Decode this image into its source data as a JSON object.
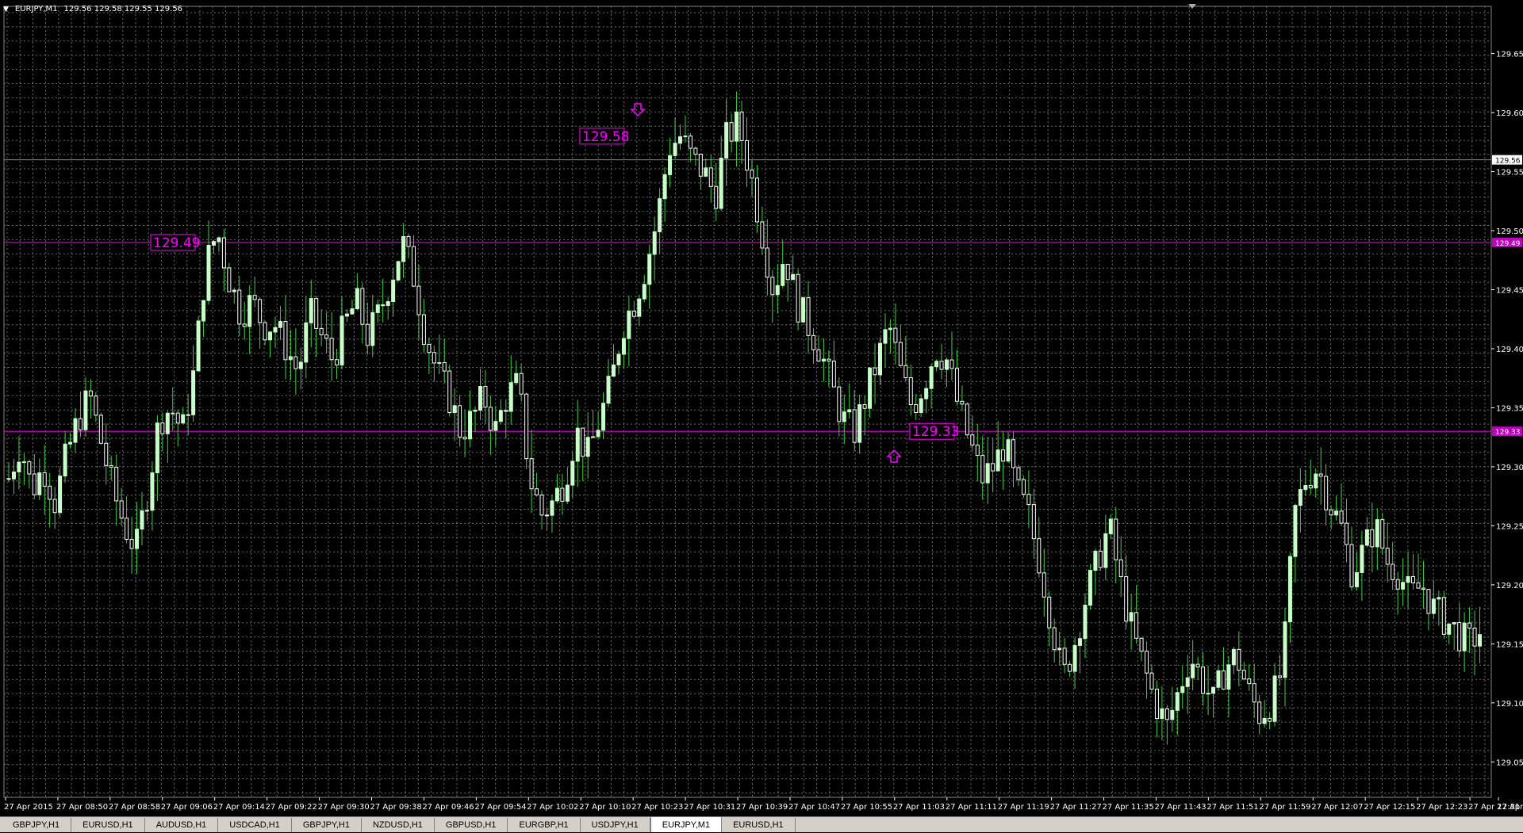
{
  "header": {
    "symbol": "EURJPY,M1",
    "ohlc": "129.56 129.58 129.55 129.56"
  },
  "colors": {
    "background": "#000000",
    "grid": "#6b6b6b",
    "bull": "#c8ffc8",
    "bear": "#ffffff",
    "wick": "#3fcf3f",
    "level": "#c000c0",
    "level_label": "#ff00ff",
    "bid_line": "#909090",
    "axis_text": "#ffffff"
  },
  "chart_data": {
    "type": "candlestick",
    "ylim": [
      129.02,
      129.69
    ],
    "price_ticks": [
      "129.65",
      "129.60",
      "129.55",
      "129.50",
      "129.45",
      "129.40",
      "129.35",
      "129.30",
      "129.25",
      "129.20",
      "129.15",
      "129.10",
      "129.05"
    ],
    "time_ticks": [
      "27 Apr 2015",
      "27 Apr 08:50",
      "27 Apr 08:58",
      "27 Apr 09:06",
      "27 Apr 09:14",
      "27 Apr 09:22",
      "27 Apr 09:30",
      "27 Apr 09:38",
      "27 Apr 09:46",
      "27 Apr 09:54",
      "27 Apr 10:02",
      "27 Apr 10:10",
      "27 Apr 10:23",
      "27 Apr 10:31",
      "27 Apr 10:39",
      "27 Apr 10:47",
      "27 Apr 10:55",
      "27 Apr 11:03",
      "27 Apr 11:11",
      "27 Apr 11:19",
      "27 Apr 11:27",
      "27 Apr 11:35",
      "27 Apr 11:43",
      "27 Apr 11:51",
      "27 Apr 11:59",
      "27 Apr 12:07",
      "27 Apr 12:15",
      "27 Apr 12:23",
      "27 Apr 12:31",
      "27 Apr 12"
    ],
    "current_price": "129.56",
    "levels": [
      {
        "price": 129.49,
        "label": "129.49",
        "axis_label": "129.49"
      },
      {
        "price": 129.33,
        "label": "129.33",
        "axis_label": "129.33"
      }
    ],
    "peak_label": "129.58",
    "close_path": [
      129.29,
      129.32,
      129.28,
      129.3,
      129.27,
      129.31,
      129.34,
      129.36,
      129.32,
      129.28,
      129.25,
      129.23,
      129.28,
      129.34,
      129.35,
      129.33,
      129.38,
      129.47,
      129.5,
      129.46,
      129.43,
      129.44,
      129.42,
      129.42,
      129.4,
      129.38,
      129.43,
      129.41,
      129.39,
      129.42,
      129.44,
      129.41,
      129.43,
      129.46,
      129.49,
      129.46,
      129.41,
      129.38,
      129.36,
      129.33,
      129.34,
      129.36,
      129.33,
      129.36,
      129.37,
      129.29,
      129.26,
      129.27,
      129.29,
      129.33,
      129.31,
      129.34,
      129.37,
      129.42,
      129.44,
      129.47,
      129.51,
      129.57,
      129.58,
      129.56,
      129.55,
      129.53,
      129.58,
      129.59,
      129.55,
      129.5,
      129.45,
      129.48,
      129.44,
      129.42,
      129.4,
      129.37,
      129.34,
      129.33,
      129.36,
      129.39,
      129.42,
      129.38,
      129.35,
      129.37,
      129.4,
      129.39,
      129.35,
      129.32,
      129.29,
      129.3,
      129.32,
      129.28,
      129.26,
      129.22,
      129.17,
      129.12,
      129.15,
      129.19,
      129.22,
      129.25,
      129.2,
      129.16,
      129.13,
      129.1,
      129.08,
      129.11,
      129.14,
      129.12,
      129.1,
      129.13,
      129.14,
      129.11,
      129.09,
      129.1,
      129.13,
      129.26,
      129.29,
      129.3,
      129.27,
      129.25,
      129.21,
      129.23,
      129.25,
      129.22,
      129.21,
      129.19,
      129.2,
      129.18,
      129.17,
      129.16,
      129.15,
      129.16
    ],
    "candle_count": 288
  },
  "tabs": [
    {
      "label": "GBPJPY,H1"
    },
    {
      "label": "EURUSD,H1"
    },
    {
      "label": "AUDUSD,H1"
    },
    {
      "label": "USDCAD,H1"
    },
    {
      "label": "GBPJPY,H1"
    },
    {
      "label": "NZDUSD,H1"
    },
    {
      "label": "GBPUSD,H1"
    },
    {
      "label": "EURGBP,H1"
    },
    {
      "label": "USDJPY,H1"
    },
    {
      "label": "EURJPY,M1",
      "active": true
    },
    {
      "label": "EURUSD,H1"
    }
  ]
}
